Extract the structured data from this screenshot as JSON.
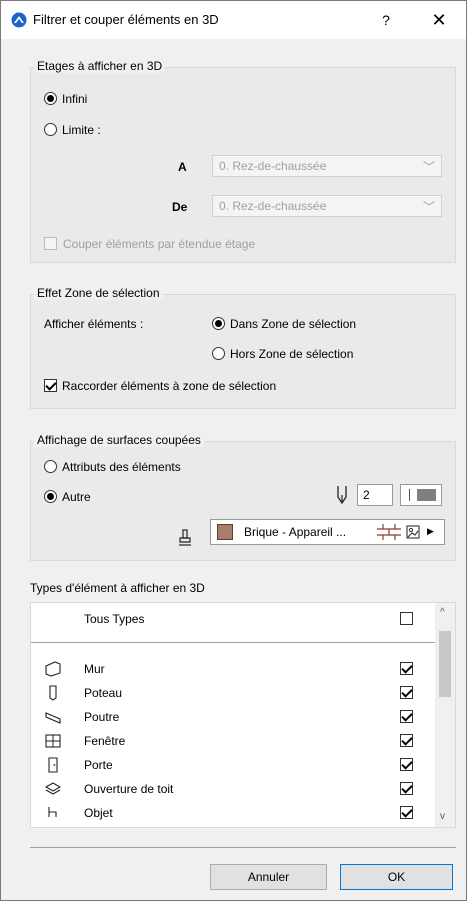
{
  "window": {
    "title": "Filtrer et couper éléments en 3D",
    "help_label": "?",
    "close_label": "✕"
  },
  "etages": {
    "group_title": "Etages à afficher en 3D",
    "infini_label": "Infini",
    "limite_label": "Limite :",
    "a_label": "A",
    "a_value": "0. Rez-de-chaussée",
    "de_label": "De",
    "de_value": "0. Rez-de-chaussée",
    "couper_label": "Couper éléments par étendue étage"
  },
  "zone": {
    "group_title": "Effet Zone de sélection",
    "afficher_label": "Afficher éléments :",
    "dans_label": "Dans Zone de sélection",
    "hors_label": "Hors Zone de sélection",
    "raccorder_label": "Raccorder éléments à zone de sélection"
  },
  "surfaces": {
    "group_title": "Affichage de surfaces coupées",
    "attributs_label": "Attributs des éléments",
    "autre_label": "Autre",
    "pen_value": "2",
    "fill_label": "Brique - Appareil ...",
    "fill_color": "#a97c6e"
  },
  "types": {
    "section_label": "Types d'élément à afficher en 3D",
    "all_label": "Tous Types",
    "items": [
      {
        "label": "Mur",
        "icon": "wall-icon",
        "checked": true
      },
      {
        "label": "Poteau",
        "icon": "column-icon",
        "checked": true
      },
      {
        "label": "Poutre",
        "icon": "beam-icon",
        "checked": true
      },
      {
        "label": "Fenêtre",
        "icon": "window-icon",
        "checked": true
      },
      {
        "label": "Porte",
        "icon": "door-icon",
        "checked": true
      },
      {
        "label": "Ouverture de toit",
        "icon": "skylight-icon",
        "checked": true
      },
      {
        "label": "Objet",
        "icon": "object-icon",
        "checked": true
      }
    ]
  },
  "buttons": {
    "cancel_label": "Annuler",
    "ok_label": "OK"
  }
}
